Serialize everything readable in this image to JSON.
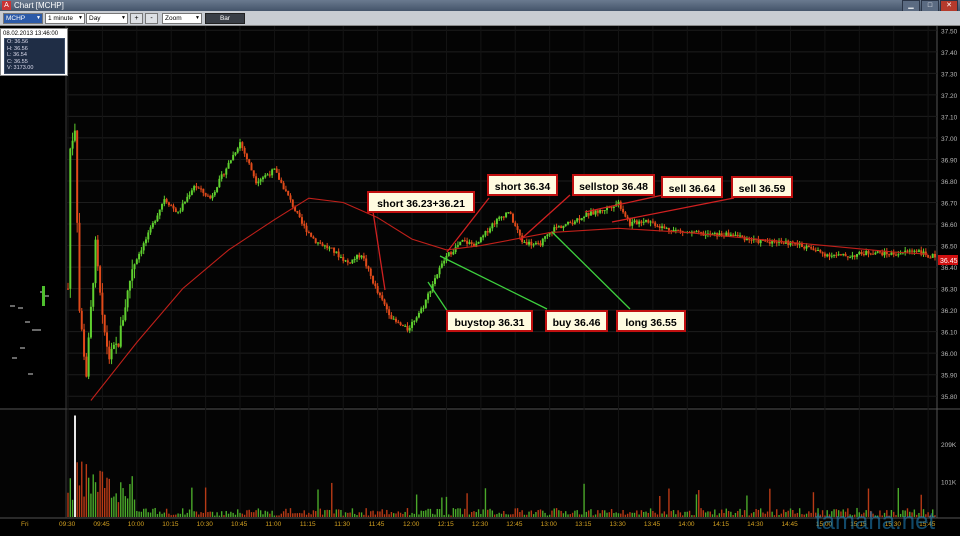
{
  "window": {
    "title": "Chart [MCHP]"
  },
  "toolbar": {
    "symbol": "MCHP",
    "interval": "1 minute",
    "range": "Day",
    "plus": "+",
    "minus": "-",
    "zoom": "Zoom",
    "bar": "Bar"
  },
  "ohlc": {
    "datetime": "08.02.2013 13:46:00",
    "open": "O: 36.56",
    "high": "H: 36.56",
    "low": "L: 36.54",
    "close": "C: 36.55",
    "volume": "V: 3173.00"
  },
  "annotations": [
    {
      "text": "short 36.23+36.21"
    },
    {
      "text": "short 36.34"
    },
    {
      "text": "sellstop 36.48"
    },
    {
      "text": "sell 36.64"
    },
    {
      "text": "sell 36.59"
    },
    {
      "text": "buystop 36.31"
    },
    {
      "text": "buy 36.46"
    },
    {
      "text": "long 36.55"
    }
  ],
  "watermark": "tamaha.net",
  "colors": {
    "bull": "#5fd02f",
    "bear": "#e04a1a",
    "ma": "#c0201a",
    "annotation_border": "#c01010",
    "last_price_bg": "#d01010"
  },
  "chart_data": [
    {
      "type": "candlestick",
      "symbol": "MCHP",
      "interval": "1 minute",
      "y_ticks": [
        "37.50",
        "37.40",
        "37.30",
        "37.20",
        "37.10",
        "37.00",
        "36.90",
        "36.80",
        "36.70",
        "36.60",
        "36.50",
        "36.40",
        "36.30",
        "36.20",
        "36.10",
        "36.00",
        "35.90",
        "35.80"
      ],
      "ylim": [
        35.75,
        37.52
      ],
      "x_ticks": [
        "Fri",
        "09:30",
        "09:45",
        "10:00",
        "10:15",
        "10:30",
        "10:45",
        "11:00",
        "11:15",
        "11:30",
        "11:45",
        "12:00",
        "12:15",
        "12:30",
        "12:45",
        "13:00",
        "13:15",
        "13:30",
        "13:45",
        "14:00",
        "14:15",
        "14:30",
        "14:45",
        "15:00",
        "15:15",
        "15:30",
        "15:45"
      ],
      "last_price": "36.45",
      "price_path": [
        [
          "09:30",
          36.3
        ],
        [
          "09:31",
          36.95
        ],
        [
          "09:33",
          37.05
        ],
        [
          "09:35",
          36.2
        ],
        [
          "09:38",
          35.9
        ],
        [
          "09:42",
          36.5
        ],
        [
          "09:45",
          36.15
        ],
        [
          "09:48",
          35.98
        ],
        [
          "09:52",
          36.05
        ],
        [
          "09:58",
          36.4
        ],
        [
          "10:05",
          36.55
        ],
        [
          "10:12",
          36.72
        ],
        [
          "10:18",
          36.65
        ],
        [
          "10:25",
          36.78
        ],
        [
          "10:32",
          36.72
        ],
        [
          "10:40",
          36.88
        ],
        [
          "10:45",
          36.98
        ],
        [
          "10:52",
          36.8
        ],
        [
          "11:00",
          36.85
        ],
        [
          "11:05",
          36.75
        ],
        [
          "11:12",
          36.6
        ],
        [
          "11:18",
          36.52
        ],
        [
          "11:25",
          36.48
        ],
        [
          "11:32",
          36.42
        ],
        [
          "11:38",
          36.46
        ],
        [
          "11:45",
          36.28
        ],
        [
          "11:52",
          36.15
        ],
        [
          "11:58",
          36.11
        ],
        [
          "12:05",
          36.22
        ],
        [
          "12:10",
          36.35
        ],
        [
          "12:15",
          36.45
        ],
        [
          "12:22",
          36.52
        ],
        [
          "12:28",
          36.5
        ],
        [
          "12:35",
          36.6
        ],
        [
          "12:42",
          36.66
        ],
        [
          "12:48",
          36.52
        ],
        [
          "12:55",
          36.5
        ],
        [
          "13:02",
          36.58
        ],
        [
          "13:08",
          36.6
        ],
        [
          "13:15",
          36.64
        ],
        [
          "13:22",
          36.66
        ],
        [
          "13:30",
          36.7
        ],
        [
          "13:35",
          36.6
        ],
        [
          "13:42",
          36.62
        ],
        [
          "13:50",
          36.58
        ],
        [
          "14:00",
          36.56
        ],
        [
          "14:10",
          36.55
        ],
        [
          "14:20",
          36.55
        ],
        [
          "14:30",
          36.52
        ],
        [
          "14:40",
          36.52
        ],
        [
          "14:50",
          36.5
        ],
        [
          "15:00",
          36.46
        ],
        [
          "15:10",
          36.45
        ],
        [
          "15:20",
          36.47
        ],
        [
          "15:30",
          36.46
        ],
        [
          "15:40",
          36.48
        ],
        [
          "15:45",
          36.45
        ]
      ],
      "moving_average": [
        [
          "09:40",
          35.78
        ],
        [
          "10:00",
          36.05
        ],
        [
          "10:20",
          36.3
        ],
        [
          "10:40",
          36.48
        ],
        [
          "11:00",
          36.62
        ],
        [
          "11:15",
          36.72
        ],
        [
          "11:30",
          36.7
        ],
        [
          "11:45",
          36.63
        ],
        [
          "12:00",
          36.53
        ],
        [
          "12:15",
          36.48
        ],
        [
          "12:30",
          36.5
        ],
        [
          "12:45",
          36.53
        ],
        [
          "13:00",
          36.56
        ],
        [
          "13:30",
          36.58
        ],
        [
          "14:00",
          36.56
        ],
        [
          "14:30",
          36.53
        ],
        [
          "15:00",
          36.5
        ],
        [
          "15:30",
          36.47
        ],
        [
          "15:45",
          36.46
        ]
      ],
      "volume_ticks": [
        "209K",
        "101K"
      ],
      "volume_ylim": [
        0,
        300
      ]
    }
  ]
}
